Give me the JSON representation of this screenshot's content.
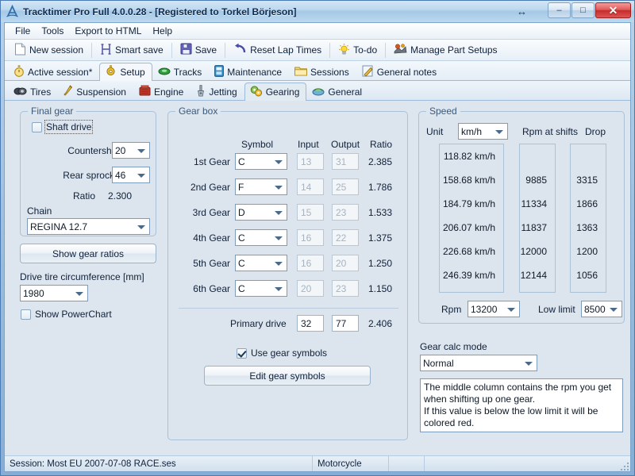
{
  "window": {
    "title": "Tracktimer Pro Full 4.0.0.28  - [Registered to Torkel Börjeson]",
    "app_icon": "tracktimer-a-icon",
    "minimize_label": "–",
    "maximize_label": "□",
    "close_label": "✕",
    "resize_hint": "↔"
  },
  "menu": {
    "items": [
      {
        "label": "File"
      },
      {
        "label": "Tools"
      },
      {
        "label": "Export to HTML"
      },
      {
        "label": "Help"
      }
    ]
  },
  "toolbar": {
    "buttons": [
      {
        "label": "New session",
        "icon": "new-document-icon"
      },
      {
        "label": "Smart save",
        "icon": "smart-save-icon"
      },
      {
        "label": "Save",
        "icon": "floppy-disk-icon"
      },
      {
        "label": "Reset Lap Times",
        "icon": "undo-arrow-icon"
      },
      {
        "label": "To-do",
        "icon": "lightbulb-icon"
      },
      {
        "label": "Manage Part Setups",
        "icon": "parts-icon"
      }
    ]
  },
  "main_tabs": {
    "items": [
      {
        "label": "Active session*",
        "icon": "stopwatch-icon",
        "active": false
      },
      {
        "label": "Setup",
        "icon": "gear-gold-icon",
        "active": true
      },
      {
        "label": "Tracks",
        "icon": "track-green-icon",
        "active": false
      },
      {
        "label": "Maintenance",
        "icon": "maintenance-icon",
        "active": false
      },
      {
        "label": "Sessions",
        "icon": "folder-icon",
        "active": false
      },
      {
        "label": "General notes",
        "icon": "pencil-note-icon",
        "active": false
      }
    ]
  },
  "sub_tabs": {
    "items": [
      {
        "label": "Tires",
        "icon": "tire-icon",
        "active": false
      },
      {
        "label": "Suspension",
        "icon": "shock-absorber-icon",
        "active": false
      },
      {
        "label": "Engine",
        "icon": "engine-icon",
        "active": false
      },
      {
        "label": "Jetting",
        "icon": "carburetor-icon",
        "active": false
      },
      {
        "label": "Gearing",
        "icon": "gears-icon",
        "active": true
      },
      {
        "label": "General",
        "icon": "general-icon",
        "active": false
      }
    ]
  },
  "final_gear": {
    "group_title": "Final gear",
    "shaft_drive": {
      "label": "Shaft drive",
      "checked": false
    },
    "countershaft": {
      "label": "Countershaft",
      "value": "20"
    },
    "rear_sprocket": {
      "label": "Rear sprocket",
      "value": "46"
    },
    "ratio": {
      "label": "Ratio",
      "value": "2.300"
    },
    "chain": {
      "label": "Chain",
      "value": "REGINA 12.7"
    }
  },
  "left_panel": {
    "show_gear_ratios_button": "Show gear ratios",
    "tire_circumference_label": "Drive tire circumference [mm]",
    "tire_circumference_value": "1980",
    "show_powerchart": {
      "label": "Show PowerChart",
      "checked": false
    }
  },
  "gear_box": {
    "group_title": "Gear box",
    "headers": {
      "symbol": "Symbol",
      "input": "Input",
      "output": "Output",
      "ratio": "Ratio"
    },
    "rows": [
      {
        "name": "1st Gear",
        "symbol": "C",
        "input": "13",
        "output": "31",
        "ratio": "2.385"
      },
      {
        "name": "2nd Gear",
        "symbol": "F",
        "input": "14",
        "output": "25",
        "ratio": "1.786"
      },
      {
        "name": "3rd Gear",
        "symbol": "D",
        "input": "15",
        "output": "23",
        "ratio": "1.533"
      },
      {
        "name": "4th Gear",
        "symbol": "C",
        "input": "16",
        "output": "22",
        "ratio": "1.375"
      },
      {
        "name": "5th Gear",
        "symbol": "C",
        "input": "16",
        "output": "20",
        "ratio": "1.250"
      },
      {
        "name": "6th Gear",
        "symbol": "C",
        "input": "20",
        "output": "23",
        "ratio": "1.150"
      }
    ],
    "primary_drive": {
      "label": "Primary drive",
      "input": "32",
      "output": "77",
      "ratio": "2.406"
    },
    "use_gear_symbols": {
      "label": "Use gear symbols",
      "checked": true
    },
    "edit_gear_symbols_button": "Edit gear symbols"
  },
  "speed": {
    "group_title": "Speed",
    "unit_label": "Unit",
    "unit_value": "km/h",
    "rpm_at_shifts_header": "Rpm at shifts",
    "drop_header": "Drop",
    "rows": [
      {
        "speed": "118.82 km/h",
        "rpm": "",
        "drop": ""
      },
      {
        "speed": "158.68 km/h",
        "rpm": "9885",
        "drop": "3315"
      },
      {
        "speed": "184.79 km/h",
        "rpm": "11334",
        "drop": "1866"
      },
      {
        "speed": "206.07 km/h",
        "rpm": "11837",
        "drop": "1363"
      },
      {
        "speed": "226.68 km/h",
        "rpm": "12000",
        "drop": "1200"
      },
      {
        "speed": "246.39 km/h",
        "rpm": "12144",
        "drop": "1056"
      }
    ],
    "rpm_label": "Rpm",
    "rpm_value": "13200",
    "low_limit_label": "Low limit",
    "low_limit_value": "8500"
  },
  "gear_calc": {
    "label": "Gear calc mode",
    "mode_value": "Normal",
    "description": "The middle column contains the rpm you get when shifting up one gear.\nIf this value is below the low limit it will be colored red."
  },
  "statusbar": {
    "session": "Session: Most EU 2007-07-08 RACE.ses",
    "vehicle": "Motorcycle",
    "pane3": "",
    "pane4": ""
  }
}
